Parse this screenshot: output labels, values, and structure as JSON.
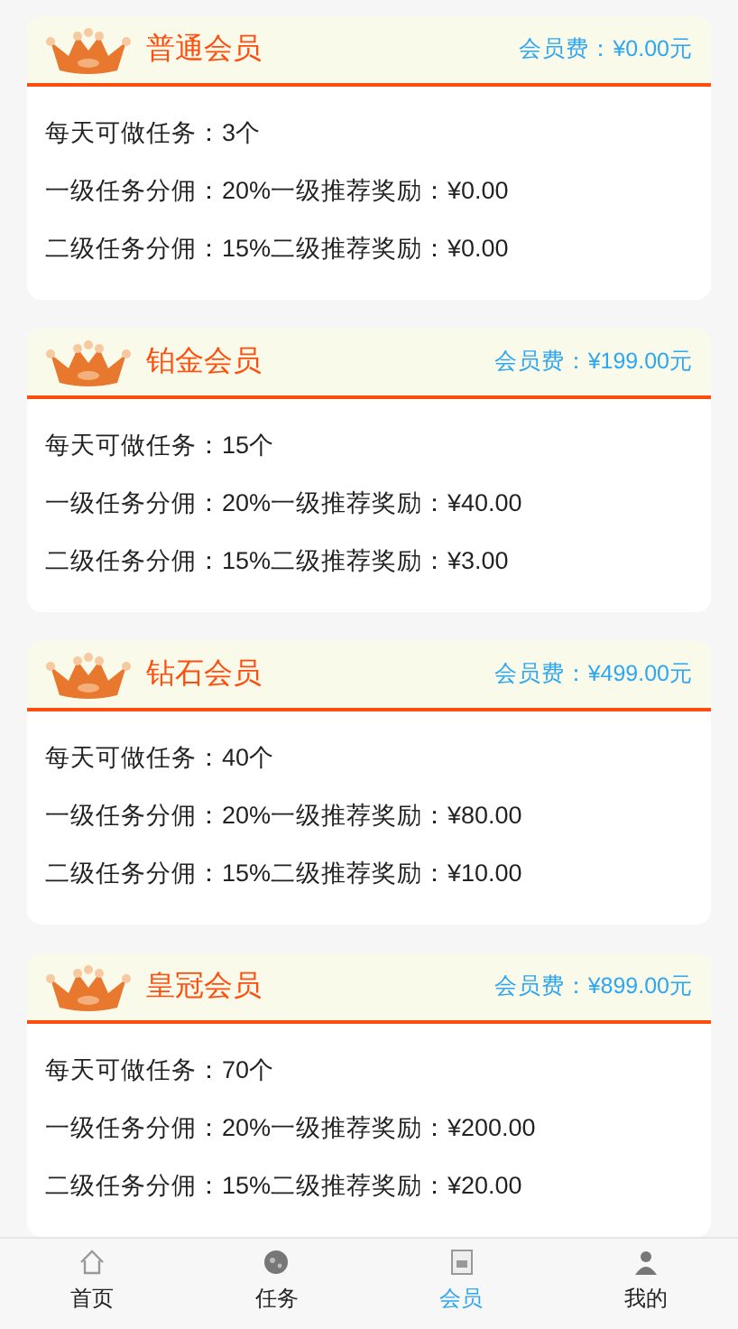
{
  "levels": [
    {
      "name": "普通会员",
      "fee": "会员费：¥0.00元",
      "lines": [
        "每天可做任务：3个",
        "一级任务分佣：20%一级推荐奖励：¥0.00",
        "二级任务分佣：15%二级推荐奖励：¥0.00"
      ]
    },
    {
      "name": "铂金会员",
      "fee": "会员费：¥199.00元",
      "lines": [
        "每天可做任务：15个",
        "一级任务分佣：20%一级推荐奖励：¥40.00",
        "二级任务分佣：15%二级推荐奖励：¥3.00"
      ]
    },
    {
      "name": "钻石会员",
      "fee": "会员费：¥499.00元",
      "lines": [
        "每天可做任务：40个",
        "一级任务分佣：20%一级推荐奖励：¥80.00",
        "二级任务分佣：15%二级推荐奖励：¥10.00"
      ]
    },
    {
      "name": "皇冠会员",
      "fee": "会员费：¥899.00元",
      "lines": [
        "每天可做任务：70个",
        "一级任务分佣：20%一级推荐奖励：¥200.00",
        "二级任务分佣：15%二级推荐奖励：¥20.00"
      ]
    }
  ],
  "tabbar": [
    {
      "label": "首页",
      "kind": "home",
      "selected": false
    },
    {
      "label": "任务",
      "kind": "task",
      "selected": false
    },
    {
      "label": "会员",
      "kind": "member",
      "selected": true
    },
    {
      "label": "我的",
      "kind": "user",
      "selected": false
    }
  ]
}
